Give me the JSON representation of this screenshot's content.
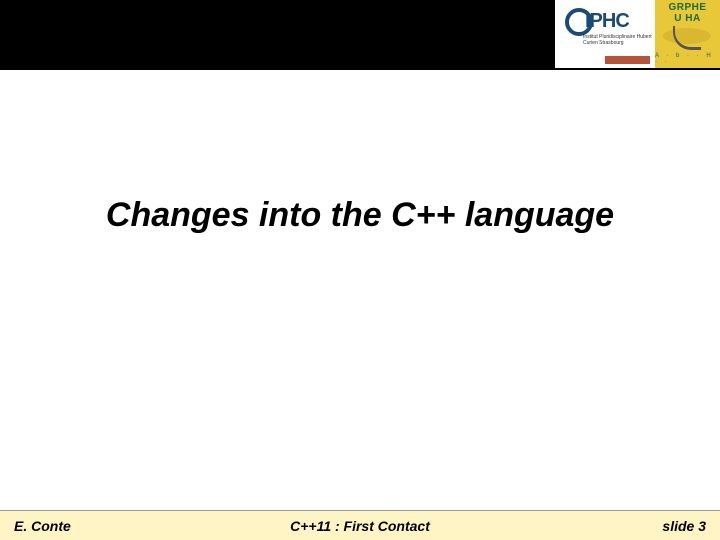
{
  "header": {
    "logos": {
      "iphc": {
        "main": "IPHC",
        "subtitle": "Institut Pluridisciplinaire\nHubert Curien\nStrasbourg"
      },
      "grphe": {
        "line1": "GRPHE",
        "line2": "U HA"
      }
    }
  },
  "main": {
    "title": "Changes into the C++ language"
  },
  "footer": {
    "author": "E. Conte",
    "center": "C++11 : First Contact",
    "slide": "slide 3"
  }
}
